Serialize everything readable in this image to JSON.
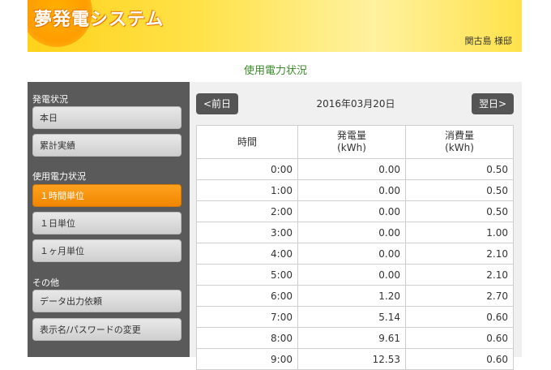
{
  "header": {
    "logo": "夢発電システム",
    "username": "関古島 様邸"
  },
  "page_title": "使用電力状況",
  "sidebar": {
    "section1_title": "発電状況",
    "section1_items": [
      "本日",
      "累計実績"
    ],
    "section2_title": "使用電力状況",
    "section2_items": [
      "１時間単位",
      "１日単位",
      "１ヶ月単位"
    ],
    "section3_title": "その他",
    "section3_items": [
      "データ出力依頼",
      "表示名/パスワードの変更"
    ],
    "active_item": "１時間単位"
  },
  "main": {
    "prev_label": "<前日",
    "next_label": "翌日>",
    "date": "2016年03月20日",
    "table": {
      "headers": [
        {
          "line1": "時間",
          "line2": ""
        },
        {
          "line1": "発電量",
          "line2": "(kWh)"
        },
        {
          "line1": "消費量",
          "line2": "(kWh)"
        }
      ],
      "rows": [
        [
          "0:00",
          "0.00",
          "0.50"
        ],
        [
          "1:00",
          "0.00",
          "0.50"
        ],
        [
          "2:00",
          "0.00",
          "0.50"
        ],
        [
          "3:00",
          "0.00",
          "1.00"
        ],
        [
          "4:00",
          "0.00",
          "2.10"
        ],
        [
          "5:00",
          "0.00",
          "2.10"
        ],
        [
          "6:00",
          "1.20",
          "2.70"
        ],
        [
          "7:00",
          "5.14",
          "0.60"
        ],
        [
          "8:00",
          "9.61",
          "0.60"
        ],
        [
          "9:00",
          "12.53",
          "0.60"
        ]
      ]
    }
  },
  "colors": {
    "accent_green": "#3a8a2a",
    "active_orange": "#f59000",
    "sidebar_bg": "#5a5a5a",
    "header_yellow": "#ffd21a"
  }
}
